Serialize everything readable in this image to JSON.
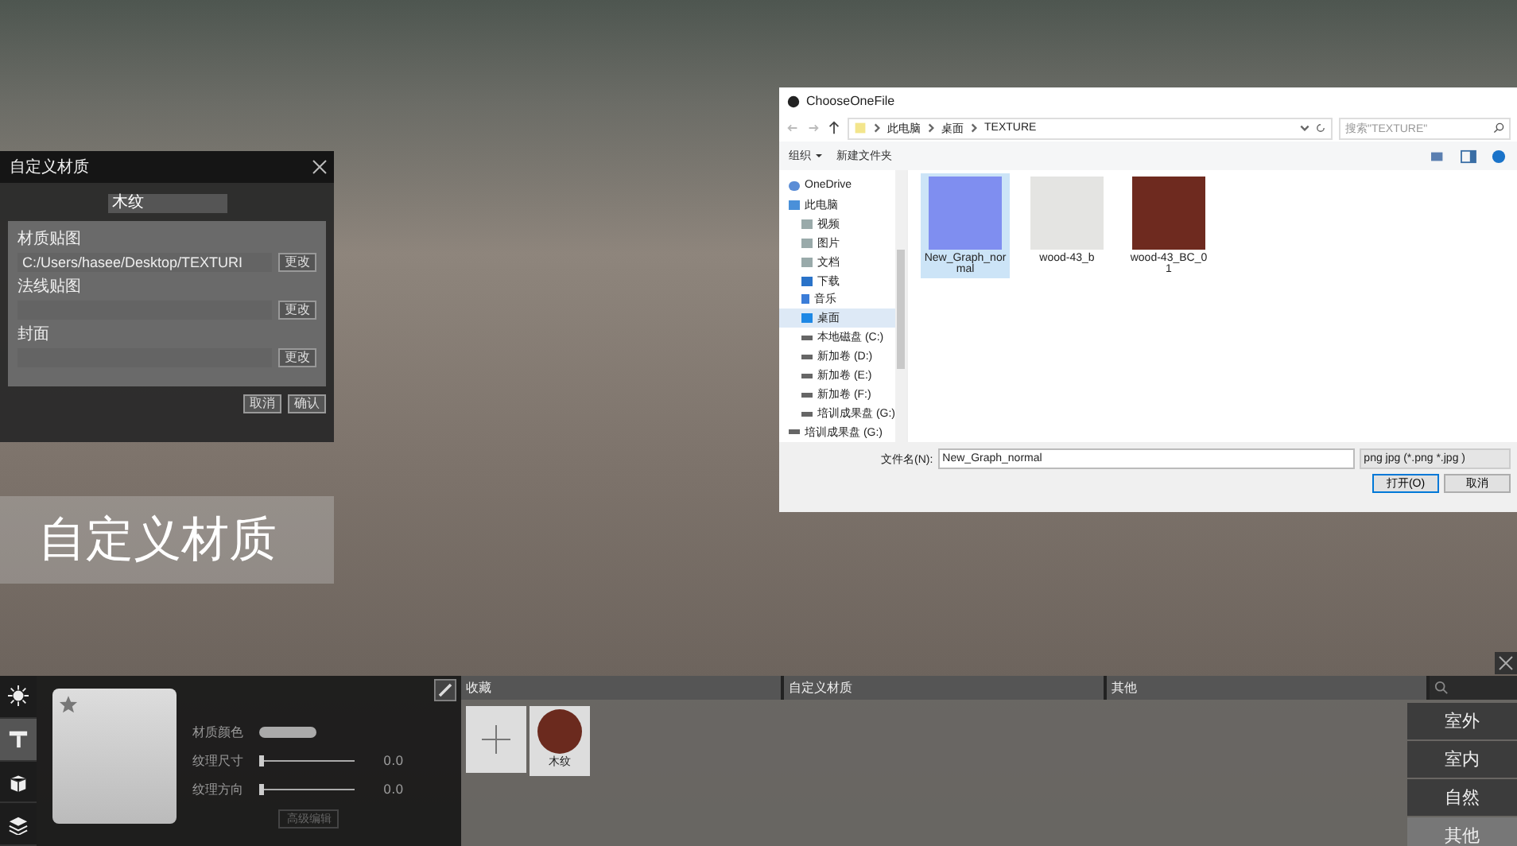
{
  "material_dialog": {
    "title": "自定义材质",
    "name": "木纹",
    "sections": [
      {
        "label": "材质贴图",
        "value": "C:/Users/hasee/Desktop/TEXTURI",
        "button": "更改"
      },
      {
        "label": "法线贴图",
        "button": "更改"
      },
      {
        "label": "封面",
        "button": "更改"
      }
    ],
    "buttons": [
      "取消",
      "确认"
    ]
  },
  "overlay_label": "自定义材质",
  "file_dialog": {
    "title": "ChooseOneFile",
    "breadcrumb": [
      "此电脑",
      "桌面",
      "TEXTURE"
    ],
    "search": {
      "placeholder": "搜索\"TEXTURE\""
    },
    "toolbar": [
      {
        "label": "组织",
        "dropdown": true
      },
      {
        "label": "新建文件夹",
        "dropdown": false
      }
    ],
    "nav": [
      {
        "label": "OneDrive",
        "kind": "cloud",
        "selected": false
      },
      {
        "label": "此电脑",
        "kind": "pc",
        "selected": false,
        "children": [
          {
            "label": "视频",
            "kind": "folder",
            "selected": false
          },
          {
            "label": "图片",
            "kind": "folder",
            "selected": false
          },
          {
            "label": "文档",
            "kind": "folder",
            "selected": false
          },
          {
            "label": "下载",
            "kind": "download",
            "selected": false
          },
          {
            "label": "音乐",
            "kind": "music",
            "selected": false
          },
          {
            "label": "桌面",
            "kind": "desktop",
            "selected": true
          },
          {
            "label": "本地磁盘 (C:)",
            "kind": "drive",
            "selected": false
          },
          {
            "label": "新加卷 (D:)",
            "kind": "drive",
            "selected": false
          },
          {
            "label": "新加卷 (E:)",
            "kind": "drive",
            "selected": false
          },
          {
            "label": "新加卷 (F:)",
            "kind": "drive",
            "selected": false
          },
          {
            "label": "培训成果盘 (G:)",
            "kind": "drive",
            "selected": false
          }
        ]
      },
      {
        "label": "培训成果盘 (G:)",
        "kind": "drive",
        "selected": false
      }
    ],
    "files": [
      {
        "name": "New_Graph_normal",
        "color": "#7f8ef0",
        "selected": true
      },
      {
        "name": "wood-43_b",
        "color": "#e4e4e2",
        "selected": false
      },
      {
        "name": "wood-43_BC_01",
        "color": "#6e2a1f",
        "selected": false
      }
    ],
    "filename_label": "文件名(N):",
    "filename": "New_Graph_normal",
    "filter": "png jpg (*.png *.jpg )",
    "buttons": [
      "打开(O)",
      "取消"
    ]
  },
  "tool_tabs": [
    {
      "kind": "sun",
      "selected": false
    },
    {
      "kind": "roller",
      "selected": true
    },
    {
      "kind": "box",
      "selected": false
    },
    {
      "kind": "layers",
      "selected": false
    }
  ],
  "properties": [
    {
      "kind": "color",
      "label": "材质颜色"
    },
    {
      "kind": "slider",
      "label": "纹理尺寸",
      "level": 0,
      "reading": "0.0"
    },
    {
      "kind": "slider",
      "label": "纹理方向",
      "level": 0,
      "reading": "0.0"
    }
  ],
  "advanced_button": {
    "label": "高级编辑",
    "disabled": true
  },
  "category_tabs": [
    "收藏",
    "自定义材质",
    "其他"
  ],
  "library_items": [
    {
      "kind": "add"
    },
    {
      "kind": "material",
      "name": "木纹",
      "color": "#6b2a1e"
    }
  ],
  "scene_buttons": [
    {
      "label": "室外",
      "selected": false
    },
    {
      "label": "室内",
      "selected": false
    },
    {
      "label": "自然",
      "selected": false
    },
    {
      "label": "其他",
      "selected": true
    }
  ]
}
